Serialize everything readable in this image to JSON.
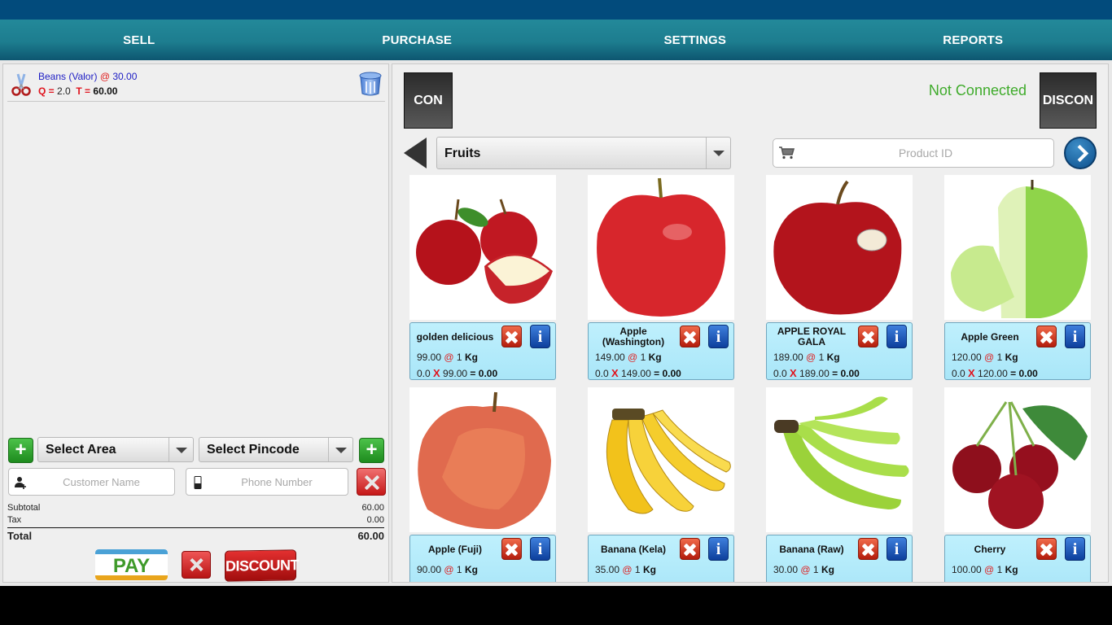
{
  "nav": {
    "tabs": [
      {
        "label": "SELL"
      },
      {
        "label": "PURCHASE"
      },
      {
        "label": "SETTINGS"
      },
      {
        "label": "REPORTS"
      }
    ]
  },
  "cart": {
    "items": [
      {
        "name": "Beans (Valor)",
        "at": "@",
        "rate": "30.00",
        "q_label": "Q =",
        "qty": "2.0",
        "t_label": "T =",
        "total": "60.00"
      }
    ]
  },
  "customer": {
    "area_select": "Select Area",
    "pincode_select": "Select Pincode",
    "name_placeholder": "Customer Name",
    "phone_placeholder": "Phone Number"
  },
  "totals": {
    "subtotal_label": "Subtotal",
    "subtotal": "60.00",
    "tax_label": "Tax",
    "tax": "0.00",
    "total_label": "Total",
    "total": "60.00"
  },
  "actions": {
    "pay_label": "PAY",
    "discount_label": "DISCOUNT"
  },
  "connection": {
    "con_label": "CON",
    "discon_label": "DISCON",
    "status": "Not Connected",
    "status_color": "#3fab2b"
  },
  "catalog": {
    "category": "Fruits",
    "product_id_placeholder": "Product ID",
    "products": [
      {
        "name": "golden delicious",
        "price": "99.00",
        "at": "@",
        "qty": "1",
        "unit": "Kg",
        "calc_qty": "0.0",
        "x": "X",
        "calc_price": "99.00",
        "eq": "=",
        "result": "0.00",
        "image": "red-apples-with-half"
      },
      {
        "name": "Apple (Washington)",
        "price": "149.00",
        "at": "@",
        "qty": "1",
        "unit": "Kg",
        "calc_qty": "0.0",
        "x": "X",
        "calc_price": "149.00",
        "eq": "=",
        "result": "0.00",
        "image": "red-apple"
      },
      {
        "name": "APPLE ROYAL GALA",
        "price": "189.00",
        "at": "@",
        "qty": "1",
        "unit": "Kg",
        "calc_qty": "0.0",
        "x": "X",
        "calc_price": "189.00",
        "eq": "=",
        "result": "0.00",
        "image": "gala-apple-with-sticker"
      },
      {
        "name": "Apple Green",
        "price": "120.00",
        "at": "@",
        "qty": "1",
        "unit": "Kg",
        "calc_qty": "0.0",
        "x": "X",
        "calc_price": "120.00",
        "eq": "=",
        "result": "0.00",
        "image": "green-apple-cut"
      },
      {
        "name": "Apple (Fuji)",
        "price": "90.00",
        "at": "@",
        "qty": "1",
        "unit": "Kg",
        "calc_qty": "",
        "x": "",
        "calc_price": "",
        "eq": "",
        "result": "",
        "image": "fuji-apple"
      },
      {
        "name": "Banana (Kela)",
        "price": "35.00",
        "at": "@",
        "qty": "1",
        "unit": "Kg",
        "calc_qty": "",
        "x": "",
        "calc_price": "",
        "eq": "",
        "result": "",
        "image": "yellow-bananas"
      },
      {
        "name": "Banana (Raw)",
        "price": "30.00",
        "at": "@",
        "qty": "1",
        "unit": "Kg",
        "calc_qty": "",
        "x": "",
        "calc_price": "",
        "eq": "",
        "result": "",
        "image": "green-bananas"
      },
      {
        "name": "Cherry",
        "price": "100.00",
        "at": "@",
        "qty": "1",
        "unit": "Kg",
        "calc_qty": "",
        "x": "",
        "calc_price": "",
        "eq": "",
        "result": "",
        "image": "cherries"
      }
    ]
  }
}
